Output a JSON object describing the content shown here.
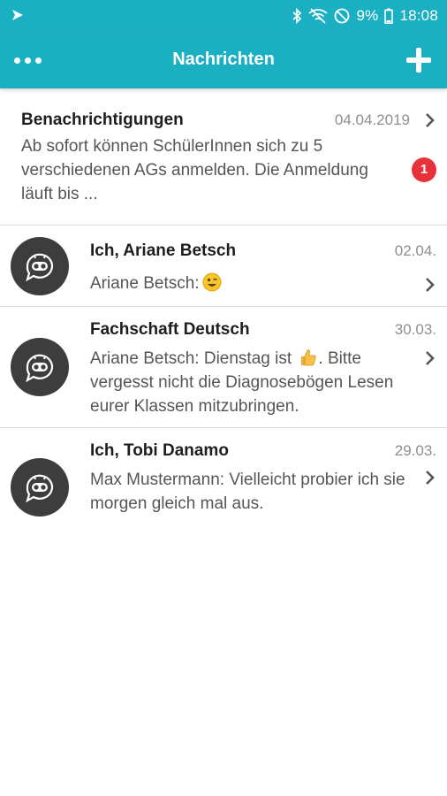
{
  "status_bar": {
    "battery_percent": "9%",
    "time": "18:08",
    "icons": [
      "app-notification-icon",
      "bluetooth-icon",
      "wifi-off-icon",
      "do-not-disturb-icon",
      "battery-icon"
    ]
  },
  "app_bar": {
    "title": "Nachrichten",
    "menu_icon": "more-horizontal-icon",
    "add_icon": "plus-icon"
  },
  "colors": {
    "accent": "#1ab0c2",
    "badge": "#e8323b",
    "avatar": "#3d3d3d"
  },
  "notification": {
    "title": "Benachrichtigungen",
    "date": "04.04.2019",
    "preview": "Ab sofort können SchülerInnen sich zu 5 verschiedenen AGs anmelden. Die Anmeldung läuft bis ...",
    "badge_count": "1"
  },
  "conversations": [
    {
      "title": "Ich, Ariane Betsch",
      "date": "02.04.",
      "preview": "Ariane Betsch:",
      "preview_emoji": "winking-face-icon"
    },
    {
      "title": "Fachschaft Deutsch",
      "date": "30.03.",
      "preview_before": "Ariane Betsch: Dienstag ist",
      "preview_emoji": "thumbs-up-icon",
      "preview_after": ". Bitte vergesst nicht die Diagnosebögen Lesen eurer Klassen mitzubringen."
    },
    {
      "title": "Ich, Tobi Danamo",
      "date": "29.03.",
      "preview": "Max Mustermann: Vielleicht probier ich sie morgen gleich mal aus."
    }
  ]
}
